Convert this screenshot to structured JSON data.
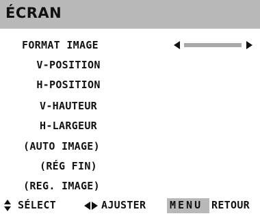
{
  "header": {
    "title": "ÉCRAN"
  },
  "menu": {
    "items": [
      {
        "label": "FORMAT IMAGE"
      },
      {
        "label": "V-POSITION"
      },
      {
        "label": "H-POSITION"
      },
      {
        "label": "V-HAUTEUR"
      },
      {
        "label": "H-LARGEUR"
      },
      {
        "label": "(AUTO IMAGE)"
      },
      {
        "label": "(RÉG FIN)"
      },
      {
        "label": "(REG. IMAGE)"
      }
    ],
    "format_image_control": {
      "type": "slider",
      "left_arrow_icon": "left-arrow-icon",
      "right_arrow_icon": "right-arrow-icon"
    }
  },
  "footer": {
    "select_icon": "up-down-arrow-icon",
    "select_label": "SÉLECT",
    "adjust_icon": "left-right-arrow-icon",
    "adjust_label": "AJUSTER",
    "menu_label": "MENU",
    "return_label": "RETOUR"
  },
  "colors": {
    "header_bg": "#b9b9b9",
    "menu_key_bg": "#b9b9b9",
    "background": "#ffffff",
    "text": "#111111",
    "slider_track": "#a8a8a8"
  }
}
